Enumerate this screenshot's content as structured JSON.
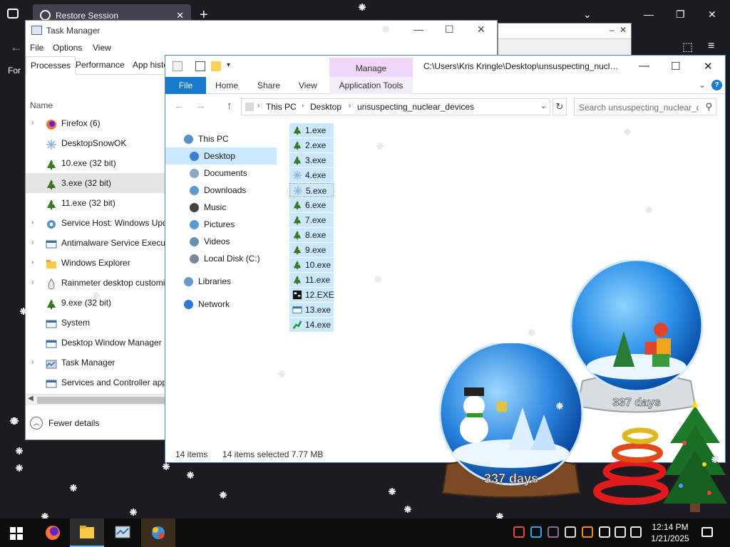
{
  "browser": {
    "tab_title": "Restore Session",
    "side_label": "For"
  },
  "task_manager": {
    "title": "Task Manager",
    "menu": [
      "File",
      "Options",
      "View"
    ],
    "tabs": [
      "Processes",
      "Performance",
      "App histo"
    ],
    "column_header": "Name",
    "processes": [
      {
        "name": "Firefox (6)",
        "expandable": true,
        "icon": "firefox-icon"
      },
      {
        "name": "DesktopSnowOK",
        "expandable": false,
        "icon": "snowflake-icon"
      },
      {
        "name": "10.exe (32 bit)",
        "expandable": false,
        "icon": "xmas-tree-icon"
      },
      {
        "name": "3.exe (32 bit)",
        "expandable": false,
        "icon": "xmas-tree-icon",
        "selected": true
      },
      {
        "name": "11.exe (32 bit)",
        "expandable": false,
        "icon": "xmas-tree-icon"
      },
      {
        "name": "Service Host: Windows Upd",
        "expandable": true,
        "icon": "gear-icon"
      },
      {
        "name": "Antimalware Service Executa",
        "expandable": true,
        "icon": "window-icon"
      },
      {
        "name": "Windows Explorer",
        "expandable": true,
        "icon": "folder-icon"
      },
      {
        "name": "Rainmeter desktop customi",
        "expandable": true,
        "icon": "droplet-icon"
      },
      {
        "name": "9.exe (32 bit)",
        "expandable": false,
        "icon": "xmas-tree-icon"
      },
      {
        "name": "System",
        "expandable": false,
        "icon": "window-icon"
      },
      {
        "name": "Desktop Window Manager",
        "expandable": false,
        "icon": "window-icon"
      },
      {
        "name": "Task Manager",
        "expandable": true,
        "icon": "taskmgr-icon"
      },
      {
        "name": "Services and Controller app",
        "expandable": false,
        "icon": "window-icon"
      }
    ],
    "fewer_details": "Fewer details"
  },
  "explorer": {
    "manage_label": "Manage",
    "title_path": "C:\\Users\\Kris Kringle\\Desktop\\unsuspecting_nuclear_devices",
    "ribbon": {
      "file": "File",
      "home": "Home",
      "share": "Share",
      "view": "View",
      "application_tools": "Application Tools"
    },
    "address": {
      "segments": [
        "This PC",
        "Desktop",
        "unsuspecting_nuclear_devices"
      ],
      "search_placeholder": "Search unsuspecting_nuclear_devices"
    },
    "nav_pane": [
      {
        "label": "This PC",
        "level": 0,
        "icon": "computer-icon"
      },
      {
        "label": "Desktop",
        "level": 1,
        "icon": "desktop-icon",
        "selected": true
      },
      {
        "label": "Documents",
        "level": 1,
        "icon": "documents-icon"
      },
      {
        "label": "Downloads",
        "level": 1,
        "icon": "downloads-icon"
      },
      {
        "label": "Music",
        "level": 1,
        "icon": "music-icon"
      },
      {
        "label": "Pictures",
        "level": 1,
        "icon": "pictures-icon"
      },
      {
        "label": "Videos",
        "level": 1,
        "icon": "videos-icon"
      },
      {
        "label": "Local Disk (C:)",
        "level": 1,
        "icon": "disk-icon"
      },
      {
        "label": "Libraries",
        "level": 0,
        "icon": "libraries-icon"
      },
      {
        "label": "Network",
        "level": 0,
        "icon": "network-icon"
      }
    ],
    "files": [
      {
        "name": "1.exe",
        "icon": "xmas-tree-icon"
      },
      {
        "name": "2.exe",
        "icon": "xmas-tree-icon"
      },
      {
        "name": "3.exe",
        "icon": "xmas-tree-icon"
      },
      {
        "name": "4.exe",
        "icon": "snowflake-icon"
      },
      {
        "name": "5.exe",
        "icon": "snowflake-icon",
        "focused": true
      },
      {
        "name": "6.exe",
        "icon": "xmas-tree-icon"
      },
      {
        "name": "7.exe",
        "icon": "xmas-tree-icon"
      },
      {
        "name": "8.exe",
        "icon": "xmas-tree-icon"
      },
      {
        "name": "9.exe",
        "icon": "xmas-tree-icon"
      },
      {
        "name": "10.exe",
        "icon": "xmas-tree-icon"
      },
      {
        "name": "11.exe",
        "icon": "xmas-tree-icon"
      },
      {
        "name": "12.EXE",
        "icon": "dark-app-icon"
      },
      {
        "name": "13.exe",
        "icon": "window-icon"
      },
      {
        "name": "14.exe",
        "icon": "green-app-icon"
      }
    ],
    "status": {
      "items": "14 items",
      "selected": "14 items selected  7.77 MB"
    }
  },
  "decorations": {
    "globe_left_label": "337 days",
    "globe_right_label": "337 days"
  },
  "taskbar": {
    "time": "12:14 PM",
    "date": "1/21/2025"
  },
  "colors": {
    "explorer_accent": "#1979ca",
    "manage_tab": "#efd7f9",
    "selection": "#cce8ff",
    "taskbar": "#0c0c0c"
  }
}
